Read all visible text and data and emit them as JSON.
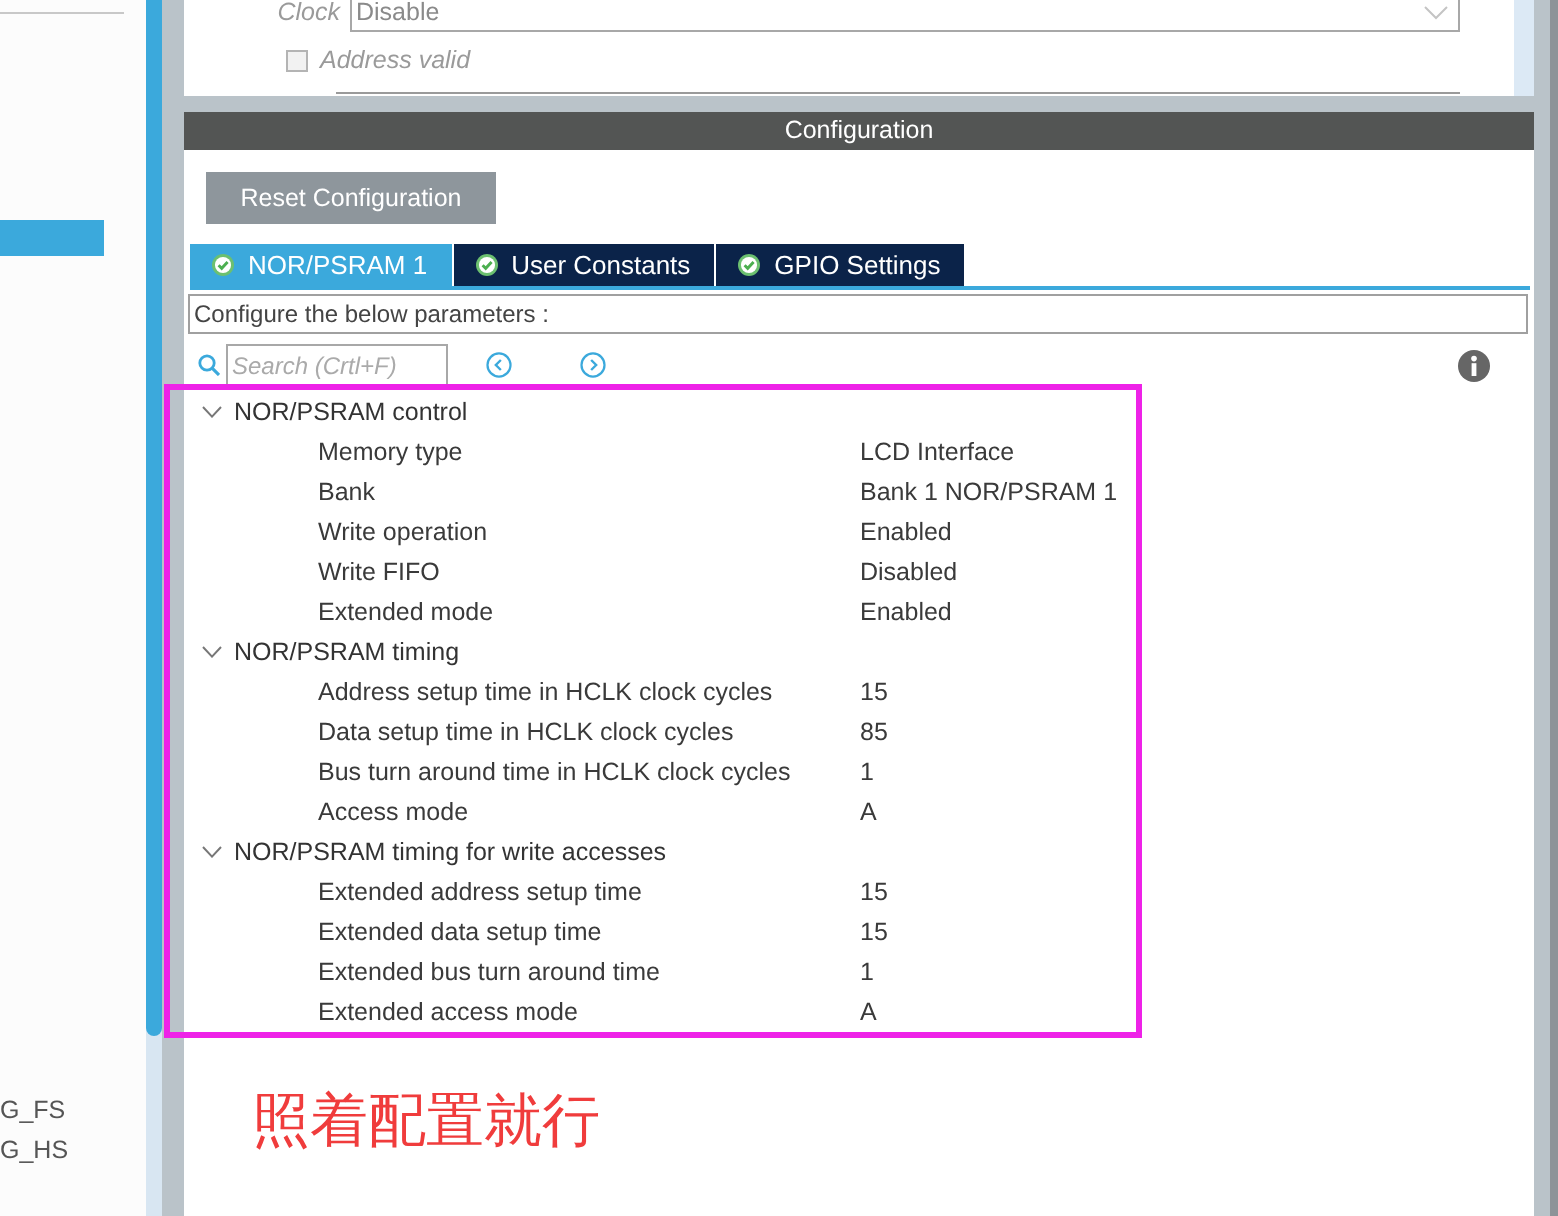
{
  "sidebar": {
    "items": [
      {
        "selected": true
      },
      {
        "label": "G_FS",
        "selected": false
      },
      {
        "label": "G_HS",
        "selected": false
      }
    ]
  },
  "top_form": {
    "fields": [
      {
        "kind": "dropdown",
        "label": "Clock",
        "value": "Disable",
        "disabled": true
      },
      {
        "kind": "checkbox",
        "label": "Address valid",
        "checked": false,
        "disabled": true
      }
    ]
  },
  "configuration": {
    "title": "Configuration",
    "reset_button": "Reset Configuration",
    "tabs": [
      {
        "label": "NOR/PSRAM 1",
        "selected": true
      },
      {
        "label": "User Constants",
        "selected": false
      },
      {
        "label": "GPIO Settings",
        "selected": false
      }
    ],
    "description": "Configure the below parameters :",
    "search": {
      "placeholder": "Search (Crtl+F)"
    },
    "tree": [
      {
        "label": "NOR/PSRAM control",
        "expanded": true,
        "children": [
          {
            "label": "Memory type",
            "value": "LCD Interface"
          },
          {
            "label": "Bank",
            "value": "Bank 1 NOR/PSRAM 1"
          },
          {
            "label": "Write operation",
            "value": "Enabled"
          },
          {
            "label": "Write FIFO",
            "value": "Disabled"
          },
          {
            "label": "Extended mode",
            "value": "Enabled"
          }
        ]
      },
      {
        "label": "NOR/PSRAM timing",
        "expanded": true,
        "children": [
          {
            "label": "Address setup time in HCLK clock cycles",
            "value": "15"
          },
          {
            "label": "Data setup time in HCLK clock cycles",
            "value": "85"
          },
          {
            "label": "Bus turn around time in HCLK clock cycles",
            "value": "1"
          },
          {
            "label": "Access mode",
            "value": "A"
          }
        ]
      },
      {
        "label": "NOR/PSRAM timing for write accesses",
        "expanded": true,
        "children": [
          {
            "label": "Extended address setup time",
            "value": "15"
          },
          {
            "label": "Extended data setup time",
            "value": "15"
          },
          {
            "label": "Extended bus turn around time",
            "value": "1"
          },
          {
            "label": "Extended access mode",
            "value": "A"
          }
        ]
      }
    ]
  },
  "annotation": {
    "text": "照着配置就行"
  }
}
